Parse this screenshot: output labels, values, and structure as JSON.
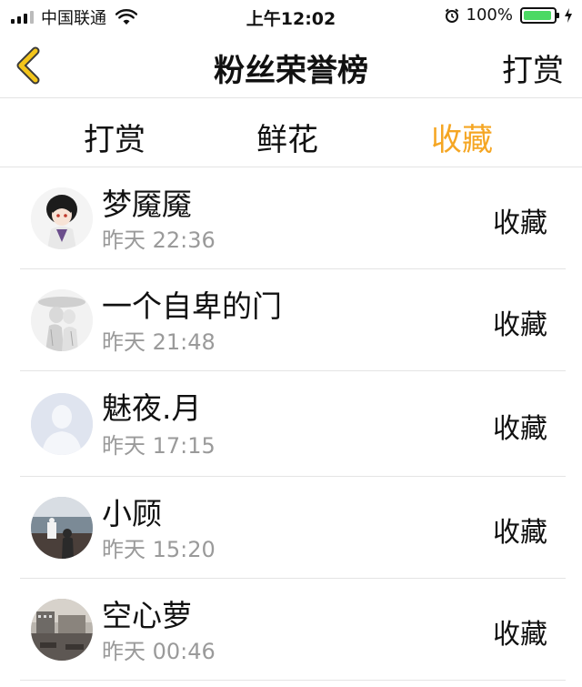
{
  "status_bar": {
    "carrier": "中国联通",
    "time": "上午12:02",
    "battery": "100%",
    "battery_level": 1.0
  },
  "nav": {
    "title": "粉丝荣誉榜",
    "action": "打赏",
    "accent": "#f3a81b"
  },
  "tabs": [
    {
      "label": "打赏",
      "active": false
    },
    {
      "label": "鲜花",
      "active": false
    },
    {
      "label": "收藏",
      "active": true
    }
  ],
  "colors": {
    "active_tab": "#f5a623",
    "text": "#111111",
    "secondary_text": "#9a9a9a"
  },
  "entries": [
    {
      "name": "梦魇魇",
      "time": "昨天 22:36",
      "action": "收藏",
      "avatar": "anime-boy-avatar"
    },
    {
      "name": "一个自卑的门",
      "time": "昨天 21:48",
      "action": "收藏",
      "avatar": "sketch-couple-avatar"
    },
    {
      "name": "魅夜.月",
      "time": "昨天 17:15",
      "action": "收藏",
      "avatar": "default-person-avatar"
    },
    {
      "name": "小顾",
      "time": "昨天 15:20",
      "action": "收藏",
      "avatar": "sea-photo-avatar"
    },
    {
      "name": "空心萝",
      "time": "昨天 00:46",
      "action": "收藏",
      "avatar": "city-photo-avatar"
    }
  ]
}
